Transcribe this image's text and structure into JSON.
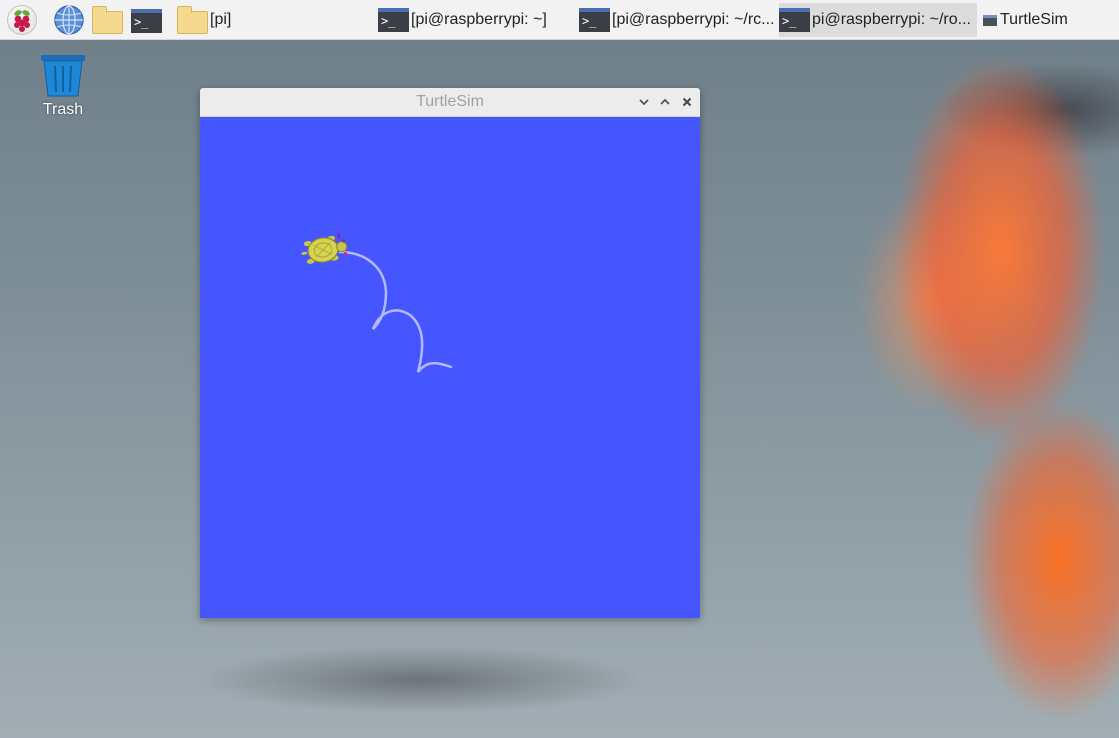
{
  "taskbar": {
    "launchers": [
      {
        "name": "raspberry-pi-menu",
        "icon": "raspberry-icon"
      },
      {
        "name": "web-browser",
        "icon": "globe-icon"
      },
      {
        "name": "file-manager",
        "icon": "folder-icon"
      },
      {
        "name": "terminal",
        "icon": "terminal-icon"
      }
    ],
    "terminal_glyph": ">_",
    "tasks": [
      {
        "label": "[pi]",
        "icon": "folder-icon",
        "active": false
      },
      {
        "label": "[pi@raspberrypi: ~]",
        "icon": "terminal-icon",
        "active": false
      },
      {
        "label": "[pi@raspberrypi: ~/rc...",
        "icon": "terminal-icon",
        "active": false
      },
      {
        "label": "pi@raspberrypi: ~/ro...",
        "icon": "terminal-icon",
        "active": true
      },
      {
        "label": "TurtleSim",
        "icon": "window-icon",
        "active": false
      }
    ]
  },
  "desktop": {
    "trash_label": "Trash"
  },
  "window": {
    "title": "TurtleSim",
    "background_color": "#4556ff",
    "controls": [
      "minimize",
      "maximize",
      "close"
    ],
    "trail_color": "#b3b9ff"
  },
  "colors": {
    "taskbar_bg": "#f2f2f2",
    "active_task_bg": "#dcdcdc",
    "terminal_bar": "#4c6fb3",
    "trash_blue": "#1e88d8"
  }
}
